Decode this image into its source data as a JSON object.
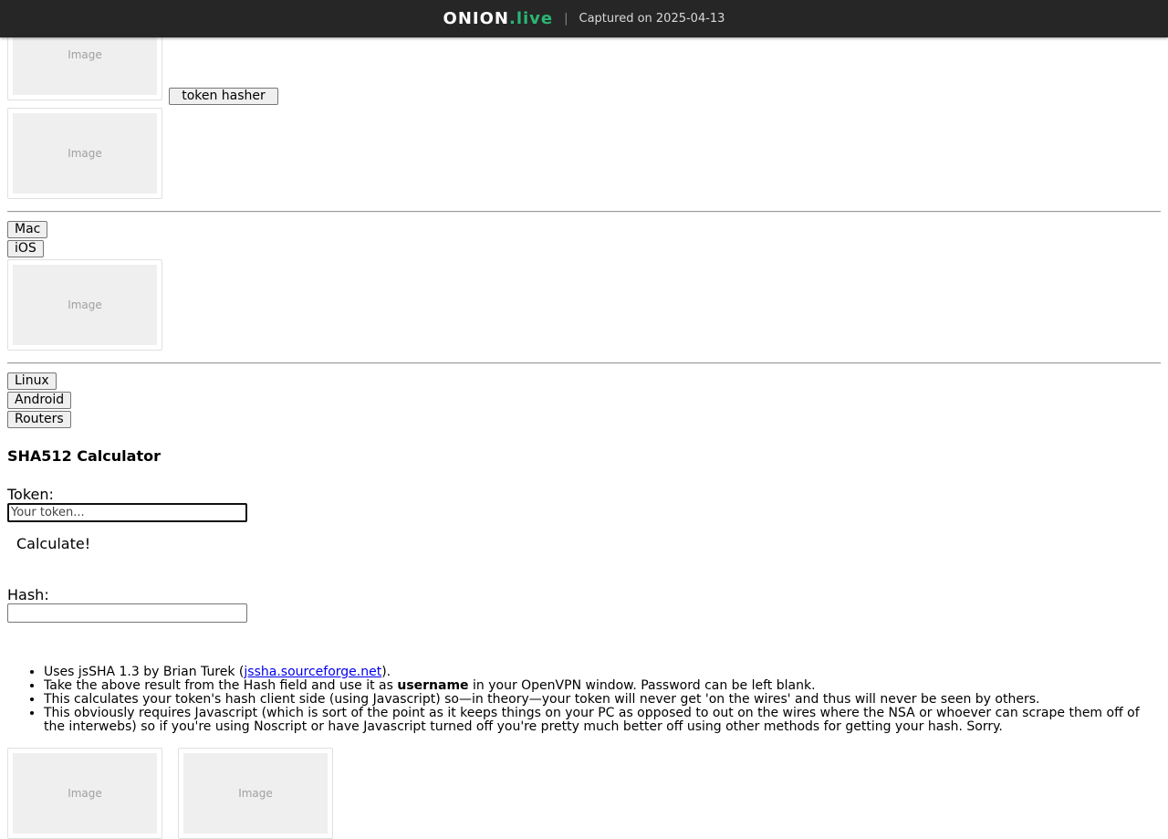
{
  "topbar": {
    "brand_main": "ONION",
    "brand_accent": ".live",
    "separator": "|",
    "captured": "Captured on 2025-04-13",
    "accent_color": "#2bb673"
  },
  "placeholders": {
    "image_label": "Image"
  },
  "buttons": {
    "token_hasher": "token hasher",
    "mac": "Mac",
    "ios": "iOS",
    "linux": "Linux",
    "android": "Android",
    "routers": "Routers"
  },
  "calculator": {
    "title": "SHA512 Calculator",
    "token_label": "Token:",
    "token_placeholder": "Your token...",
    "calculate_label": "Calculate!",
    "hash_label": "Hash:",
    "hash_value": ""
  },
  "notes": {
    "n1_prefix": "Uses jsSHA 1.3 by Brian Turek (",
    "n1_link": "jssha.sourceforge.net",
    "n1_suffix": ").",
    "n2_prefix": "Take the above result from the Hash field and use it as ",
    "n2_bold": "username",
    "n2_suffix": " in your OpenVPN window. Password can be left blank.",
    "n3": "This calculates your token's hash client side (using Javascript) so—in theory—your token will never get 'on the wires' and thus will never be seen by others.",
    "n4": "This obviously requires Javascript (which is sort of the point as it keeps things on your PC as opposed to out on the wires where the NSA or whoever can scrape them off of the interwebs) so if you're using Noscript or have Javascript turned off you're pretty much better off using other methods for getting your hash. Sorry."
  }
}
